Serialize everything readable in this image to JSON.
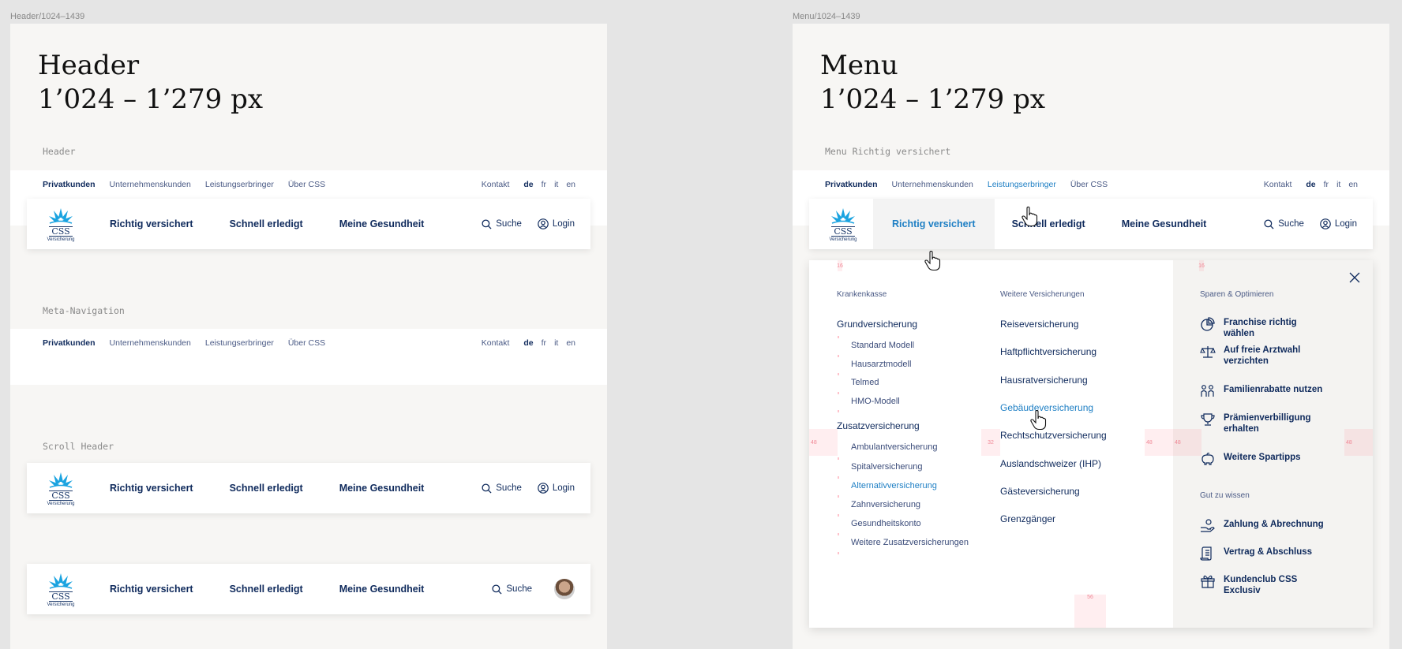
{
  "frames": {
    "left_label": "Header/1024–1439",
    "right_label": "Menu/1024–1439"
  },
  "left": {
    "title_line1": "Header",
    "title_line2": "1’024 – 1’279 px",
    "label_header": "Header",
    "label_meta": "Meta-Navigation",
    "label_scroll": "Scroll Header"
  },
  "right": {
    "title_line1": "Menu",
    "title_line2": "1’024 – 1’279 px",
    "label_menu": "Menu Richtig versichert"
  },
  "meta_nav": {
    "items": [
      "Privatkunden",
      "Unternehmenskunden",
      "Leistungserbringer",
      "Über CSS"
    ],
    "contact": "Kontakt",
    "languages": [
      "de",
      "fr",
      "it",
      "en"
    ]
  },
  "logo": {
    "text": "CSS",
    "sub": "Versicherung"
  },
  "main_nav": {
    "items": [
      "Richtig versichert",
      "Schnell erledigt",
      "Meine Gesundheit"
    ],
    "search": "Suche",
    "login": "Login"
  },
  "menu": {
    "col1_head": "Krankenkasse",
    "col1_group1": "Grundversicherung",
    "col1_group1_items": [
      "Standard Modell",
      "Hausarztmodell",
      "Telmed",
      "HMO-Modell"
    ],
    "col1_group2": "Zusatzversicherung",
    "col1_group2_items": [
      "Ambulantversicherung",
      "Spitalversicherung",
      "Alternativversicherung",
      "Zahnversicherung",
      "Gesundheitskonto",
      "Weitere Zusatzversicherungen"
    ],
    "col2_head": "Weitere Versicherungen",
    "col2_items": [
      "Reiseversicherung",
      "Haftpflichtversicherung",
      "Hausratversicherung",
      "Gebäudeversicherung",
      "Rechtschutzversicherung",
      "Auslandschweizer (IHP)",
      "Gästeversicherung",
      "Grenzgänger"
    ],
    "col3_head1": "Sparen & Optimieren",
    "col3_tips1": [
      "Franchise richtig wählen",
      "Auf freie Arztwahl verzichten",
      "Familienrabatte nutzen",
      "Prämienverbilligung erhalten",
      "Weitere Spartipps"
    ],
    "col3_head2": "Gut zu wissen",
    "col3_tips2": [
      "Zahlung & Abrechnung",
      "Vertrag & Abschluss",
      "Kundenclub CSS Exclusiv"
    ]
  },
  "spacing_marks": {
    "s16": "16",
    "s48": "48",
    "s32": "32",
    "s56": "56"
  },
  "colors": {
    "navy": "#0f2a5c",
    "accent": "#1e7fc4",
    "background": "#f7f6f4"
  }
}
